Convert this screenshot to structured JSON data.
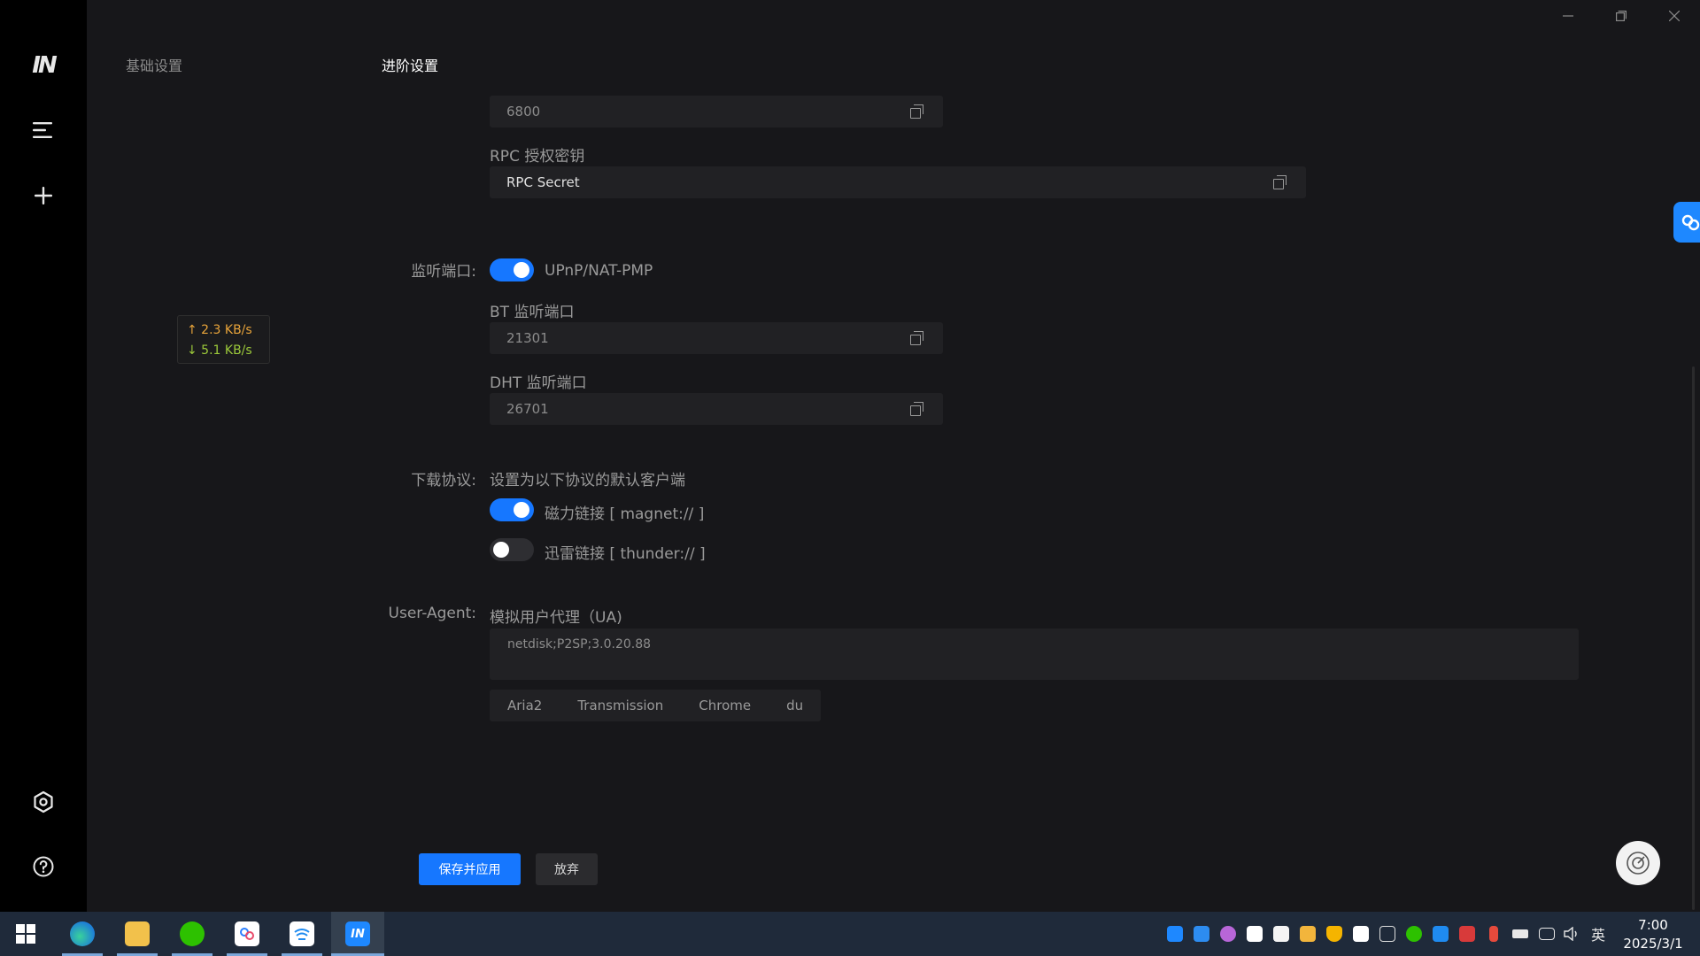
{
  "rail": {
    "logo": "IN"
  },
  "nav": {
    "basic": "基础设置",
    "advanced": "进阶设置"
  },
  "speed": {
    "upload": "↑ 2.3 KB/s",
    "download": "↓ 5.1 KB/s"
  },
  "rpc": {
    "port_value": "6800",
    "secret_label": "RPC 授权密钥",
    "secret_value": "RPC Secret"
  },
  "listen": {
    "label": "监听端口:",
    "upnp_label": "UPnP/NAT-PMP",
    "upnp_enabled": true,
    "bt_label": "BT 监听端口",
    "bt_value": "21301",
    "dht_label": "DHT 监听端口",
    "dht_value": "26701"
  },
  "protocol": {
    "label": "下载协议:",
    "description": "设置为以下协议的默认客户端",
    "magnet_label": "磁力链接 [ magnet:// ]",
    "magnet_enabled": true,
    "thunder_label": "迅雷链接 [ thunder:// ]",
    "thunder_enabled": false
  },
  "ua": {
    "label": "User-Agent:",
    "description": "模拟用户代理（UA)",
    "value": "netdisk;P2SP;3.0.20.88",
    "presets": [
      "Aria2",
      "Transmission",
      "Chrome",
      "du"
    ]
  },
  "actions": {
    "save": "保存并应用",
    "cancel": "放弃"
  },
  "taskbar": {
    "clock_time": "7:00",
    "clock_date": "2025/3/1",
    "ime": "英"
  },
  "colors": {
    "accent": "#1677ff",
    "background": "#17171a",
    "rail": "#000000",
    "upload": "#e8a43a",
    "download": "#9cc93a"
  }
}
